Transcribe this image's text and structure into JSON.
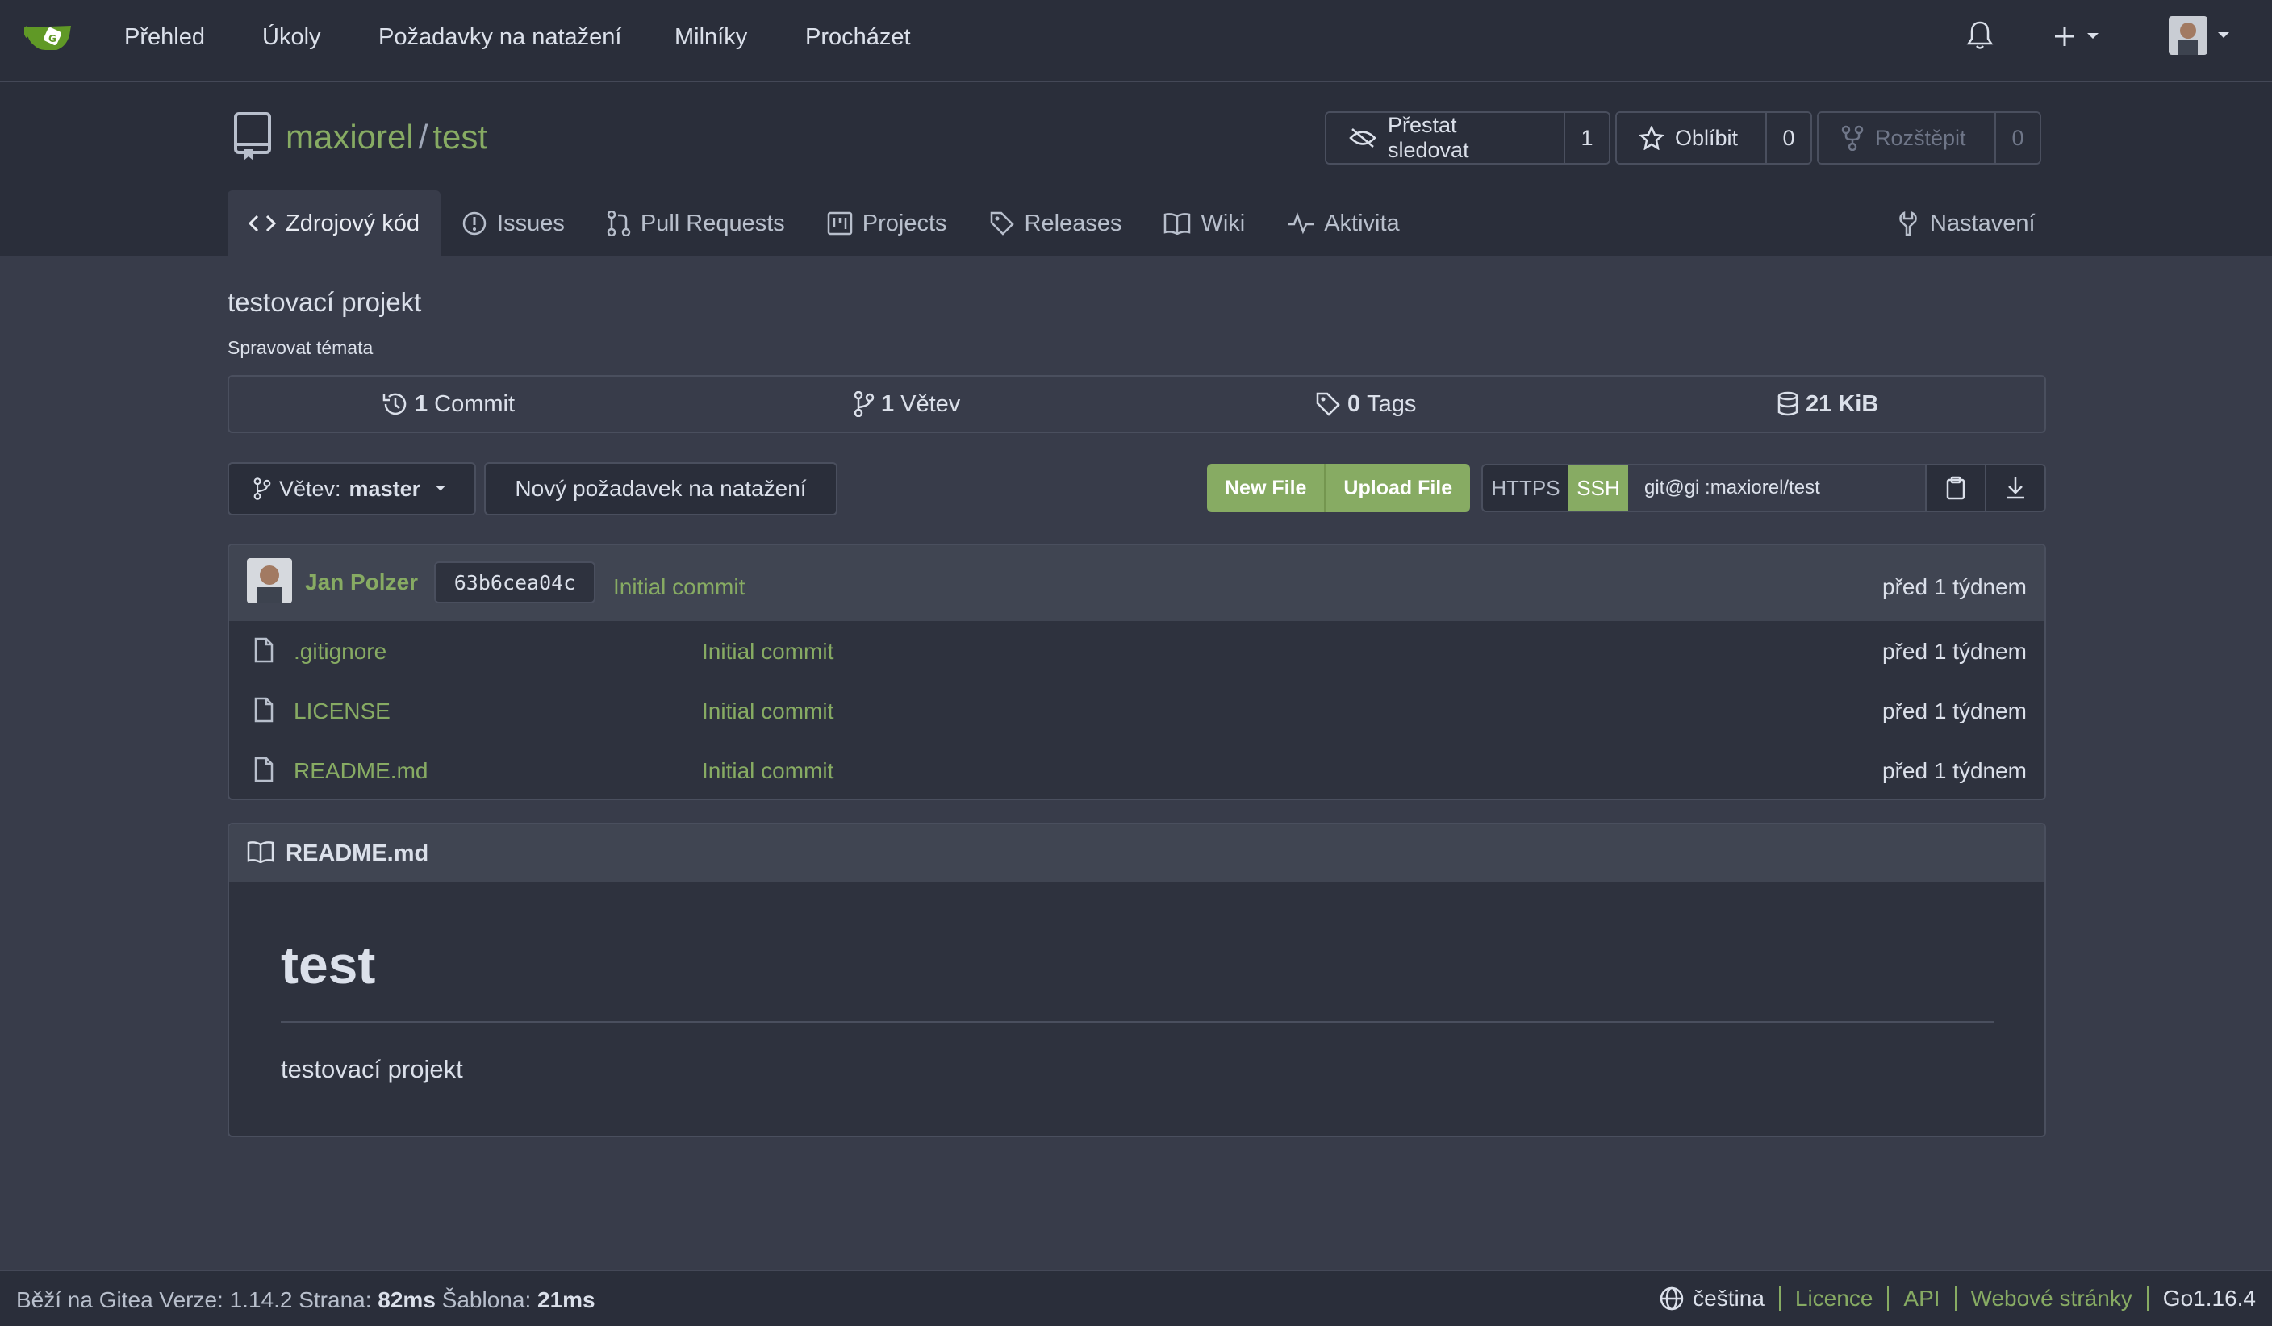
{
  "nav": {
    "items": [
      "Přehled",
      "Úkoly",
      "Požadavky na natažení",
      "Milníky",
      "Procházet"
    ],
    "icons": [
      "bell-icon",
      "plus-icon",
      "avatar"
    ]
  },
  "repo": {
    "owner": "maxiorel",
    "sep": "/",
    "name": "test",
    "watch": {
      "label": "Přestat sledovat",
      "count": "1"
    },
    "star": {
      "label": "Oblíbit",
      "count": "0"
    },
    "fork": {
      "label": "Rozštěpit",
      "count": "0"
    },
    "tabs": [
      {
        "label": "Zdrojový kód",
        "icon": "code-icon"
      },
      {
        "label": "Issues",
        "icon": "issue-icon"
      },
      {
        "label": "Pull Requests",
        "icon": "git-pull-request-icon"
      },
      {
        "label": "Projects",
        "icon": "project-icon"
      },
      {
        "label": "Releases",
        "icon": "tag-icon"
      },
      {
        "label": "Wiki",
        "icon": "book-icon"
      },
      {
        "label": "Aktivita",
        "icon": "pulse-icon"
      }
    ],
    "settings_label": "Nastavení",
    "description": "testovací projekt",
    "topics_label": "Spravovat témata"
  },
  "stats": {
    "commits": {
      "num": "1",
      "label": "Commit"
    },
    "branches": {
      "num": "1",
      "label": "Větev"
    },
    "tags": {
      "num": "0",
      "label": "Tags"
    },
    "size": "21 KiB"
  },
  "toolbar": {
    "branch_prefix": "Větev:",
    "branch": "master",
    "new_pr": "Nový požadavek na natažení",
    "new_file": "New File",
    "upload_file": "Upload File",
    "https": "HTTPS",
    "ssh": "SSH",
    "clone_url": "git@gi       :maxiorel/test"
  },
  "latest_commit": {
    "author": "Jan Polzer",
    "sha": "63b6cea04c",
    "message": "Initial commit",
    "time": "před 1 týdnem"
  },
  "files": [
    {
      "name": ".gitignore",
      "message": "Initial commit",
      "time": "před 1 týdnem"
    },
    {
      "name": "LICENSE",
      "message": "Initial commit",
      "time": "před 1 týdnem"
    },
    {
      "name": "README.md",
      "message": "Initial commit",
      "time": "před 1 týdnem"
    }
  ],
  "readme": {
    "filename": "README.md",
    "heading": "test",
    "body": "testovací projekt"
  },
  "footer": {
    "powered": "Běží na Gitea Verze: 1.14.2 Strana:",
    "page_time": "82ms",
    "template_label": "Šablona:",
    "template_time": "21ms",
    "language": "čeština",
    "license": "Licence",
    "api": "API",
    "website": "Webové stránky",
    "go": "Go1.16.4"
  },
  "colors": {
    "accent": "#87ab63",
    "navbar": "#2a2e3a",
    "background": "#383c4a"
  }
}
